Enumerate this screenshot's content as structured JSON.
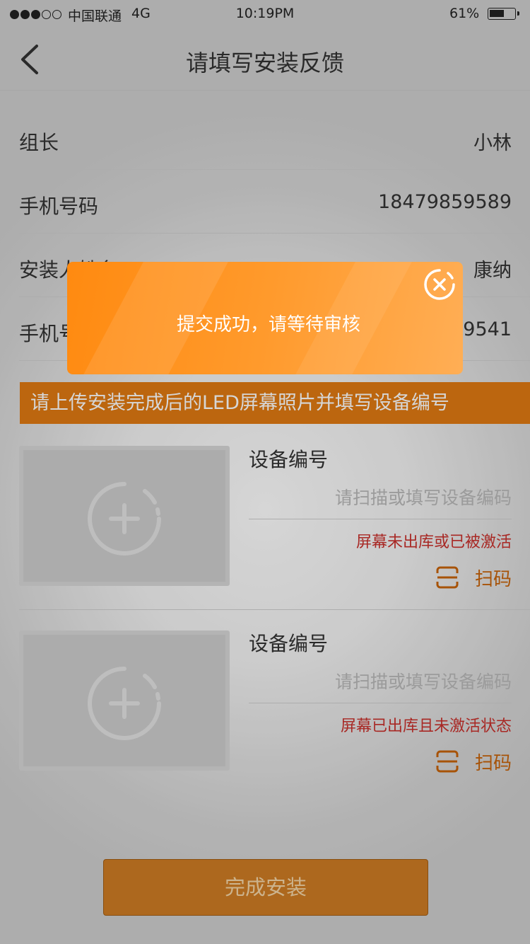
{
  "status_bar": {
    "signal_full": 3,
    "signal_total": 5,
    "carrier": "中国联通",
    "network": "4G",
    "time": "10:19PM",
    "battery_pct_label": "61%",
    "battery_level": 0.61
  },
  "nav": {
    "back_icon": "chevron-left-icon",
    "title": "请填写安装反馈"
  },
  "info_rows": [
    {
      "label": "组长",
      "value": "小林"
    },
    {
      "label": "手机号码",
      "value": "18479859589"
    },
    {
      "label": "安装人姓名",
      "value": "康纳"
    },
    {
      "label": "手机号码",
      "value": "18479859541"
    }
  ],
  "banner": "请上传安装完成后的LED屏幕照片并填写设备编号",
  "devices": [
    {
      "label": "设备编号",
      "input_value": "",
      "placeholder": "请扫描或填写设备编码",
      "status": "屏幕未出库或已被激活",
      "scan_label": "扫码"
    },
    {
      "label": "设备编号",
      "input_value": "",
      "placeholder": "请扫描或填写设备编码",
      "status": "屏幕已出库且未激活状态",
      "scan_label": "扫码"
    }
  ],
  "complete_button": "完成安装",
  "toast": {
    "message": "提交成功，请等待审核",
    "close_icon": "close-circle-icon"
  },
  "colors": {
    "accent": "#e07a12",
    "toast_start": "#ff8a10",
    "toast_end": "#ffae55",
    "error": "#c9302c",
    "scan": "#c8640a"
  }
}
